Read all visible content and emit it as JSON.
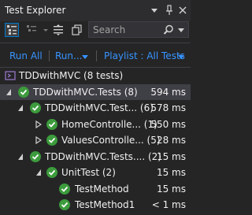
{
  "window": {
    "title": "Test Explorer"
  },
  "toolbar": {
    "search_placeholder": "Search"
  },
  "actions": {
    "run_all": "Run All",
    "run": "Run...",
    "playlist": "Playlist : All Tests"
  },
  "tree": {
    "root": "TDDwithMVC (8 tests)",
    "rows": [
      {
        "label": "TDDwithMVC.Tests (8)",
        "duration": "594 ms"
      },
      {
        "label": "TDDwithMVC.Test... (6)",
        "duration": "578 ms"
      },
      {
        "label": "HomeControlle... (1)",
        "duration": "550 ms"
      },
      {
        "label": "ValuesControlle... (5)",
        "duration": "28 ms"
      },
      {
        "label": "TDDwithMVC.Tests.... (2)",
        "duration": "15 ms"
      },
      {
        "label": "UnitTest (2)",
        "duration": "15 ms"
      },
      {
        "label": "TestMethod",
        "duration": "15 ms"
      },
      {
        "label": "TestMethod1",
        "duration": "< 1 ms"
      }
    ]
  },
  "colors": {
    "passed": "#3c9b3c",
    "link": "#3794ff",
    "background": "#252526"
  },
  "icons": [
    "pin-icon",
    "close-icon",
    "window-menu-icon",
    "group-by-icon",
    "search-icon"
  ]
}
